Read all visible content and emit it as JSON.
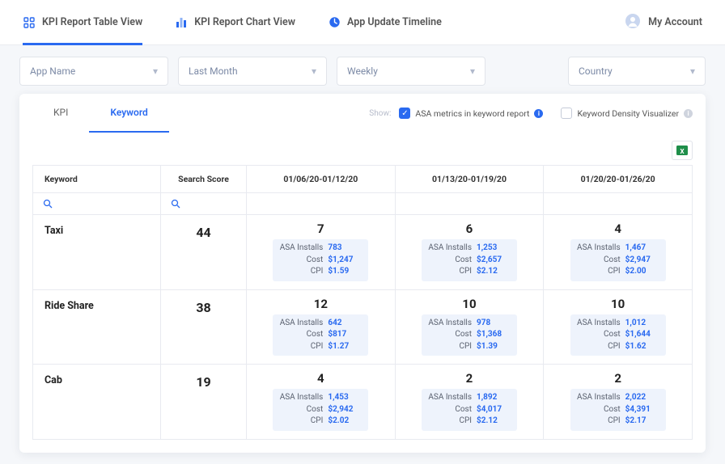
{
  "header": {
    "tabs": [
      {
        "label": "KPI Report Table View",
        "icon": "grid-icon"
      },
      {
        "label": "KPI Report Chart View",
        "icon": "bars-icon"
      },
      {
        "label": "App Update Timeline",
        "icon": "clock-icon"
      }
    ],
    "account_label": "My Account"
  },
  "filters": {
    "app_name": "App Name",
    "date_range": "Last Month",
    "interval": "Weekly",
    "country": "Country"
  },
  "subtabs": {
    "kpi": "KPI",
    "keyword": "Keyword"
  },
  "show": {
    "label": "Show:",
    "asa_label": "ASA metrics in keyword report",
    "density_label": "Keyword Density Visualizer"
  },
  "table": {
    "headers": {
      "keyword": "Keyword",
      "score": "Search Score",
      "periods": [
        "01/06/20-01/12/20",
        "01/13/20-01/19/20",
        "01/20/20-01/26/20"
      ]
    },
    "metric_labels": {
      "installs": "ASA Installs",
      "cost": "Cost",
      "cpi": "CPI"
    },
    "rows": [
      {
        "keyword": "Taxi",
        "score": "44",
        "cells": [
          {
            "rank": "7",
            "installs": "783",
            "cost": "$1,247",
            "cpi": "$1.59"
          },
          {
            "rank": "6",
            "installs": "1,253",
            "cost": "$2,657",
            "cpi": "$2.12"
          },
          {
            "rank": "4",
            "installs": "1,467",
            "cost": "$2,947",
            "cpi": "$2.00"
          }
        ]
      },
      {
        "keyword": "Ride Share",
        "score": "38",
        "cells": [
          {
            "rank": "12",
            "installs": "642",
            "cost": "$817",
            "cpi": "$1.27"
          },
          {
            "rank": "10",
            "installs": "978",
            "cost": "$1,368",
            "cpi": "$1.39"
          },
          {
            "rank": "10",
            "installs": "1,012",
            "cost": "$1,644",
            "cpi": "$1.62"
          }
        ]
      },
      {
        "keyword": "Cab",
        "score": "19",
        "cells": [
          {
            "rank": "4",
            "installs": "1,453",
            "cost": "$2,942",
            "cpi": "$2.02"
          },
          {
            "rank": "2",
            "installs": "1,892",
            "cost": "$4,017",
            "cpi": "$2.12"
          },
          {
            "rank": "2",
            "installs": "2,022",
            "cost": "$4,391",
            "cpi": "$2.17"
          }
        ]
      }
    ]
  }
}
